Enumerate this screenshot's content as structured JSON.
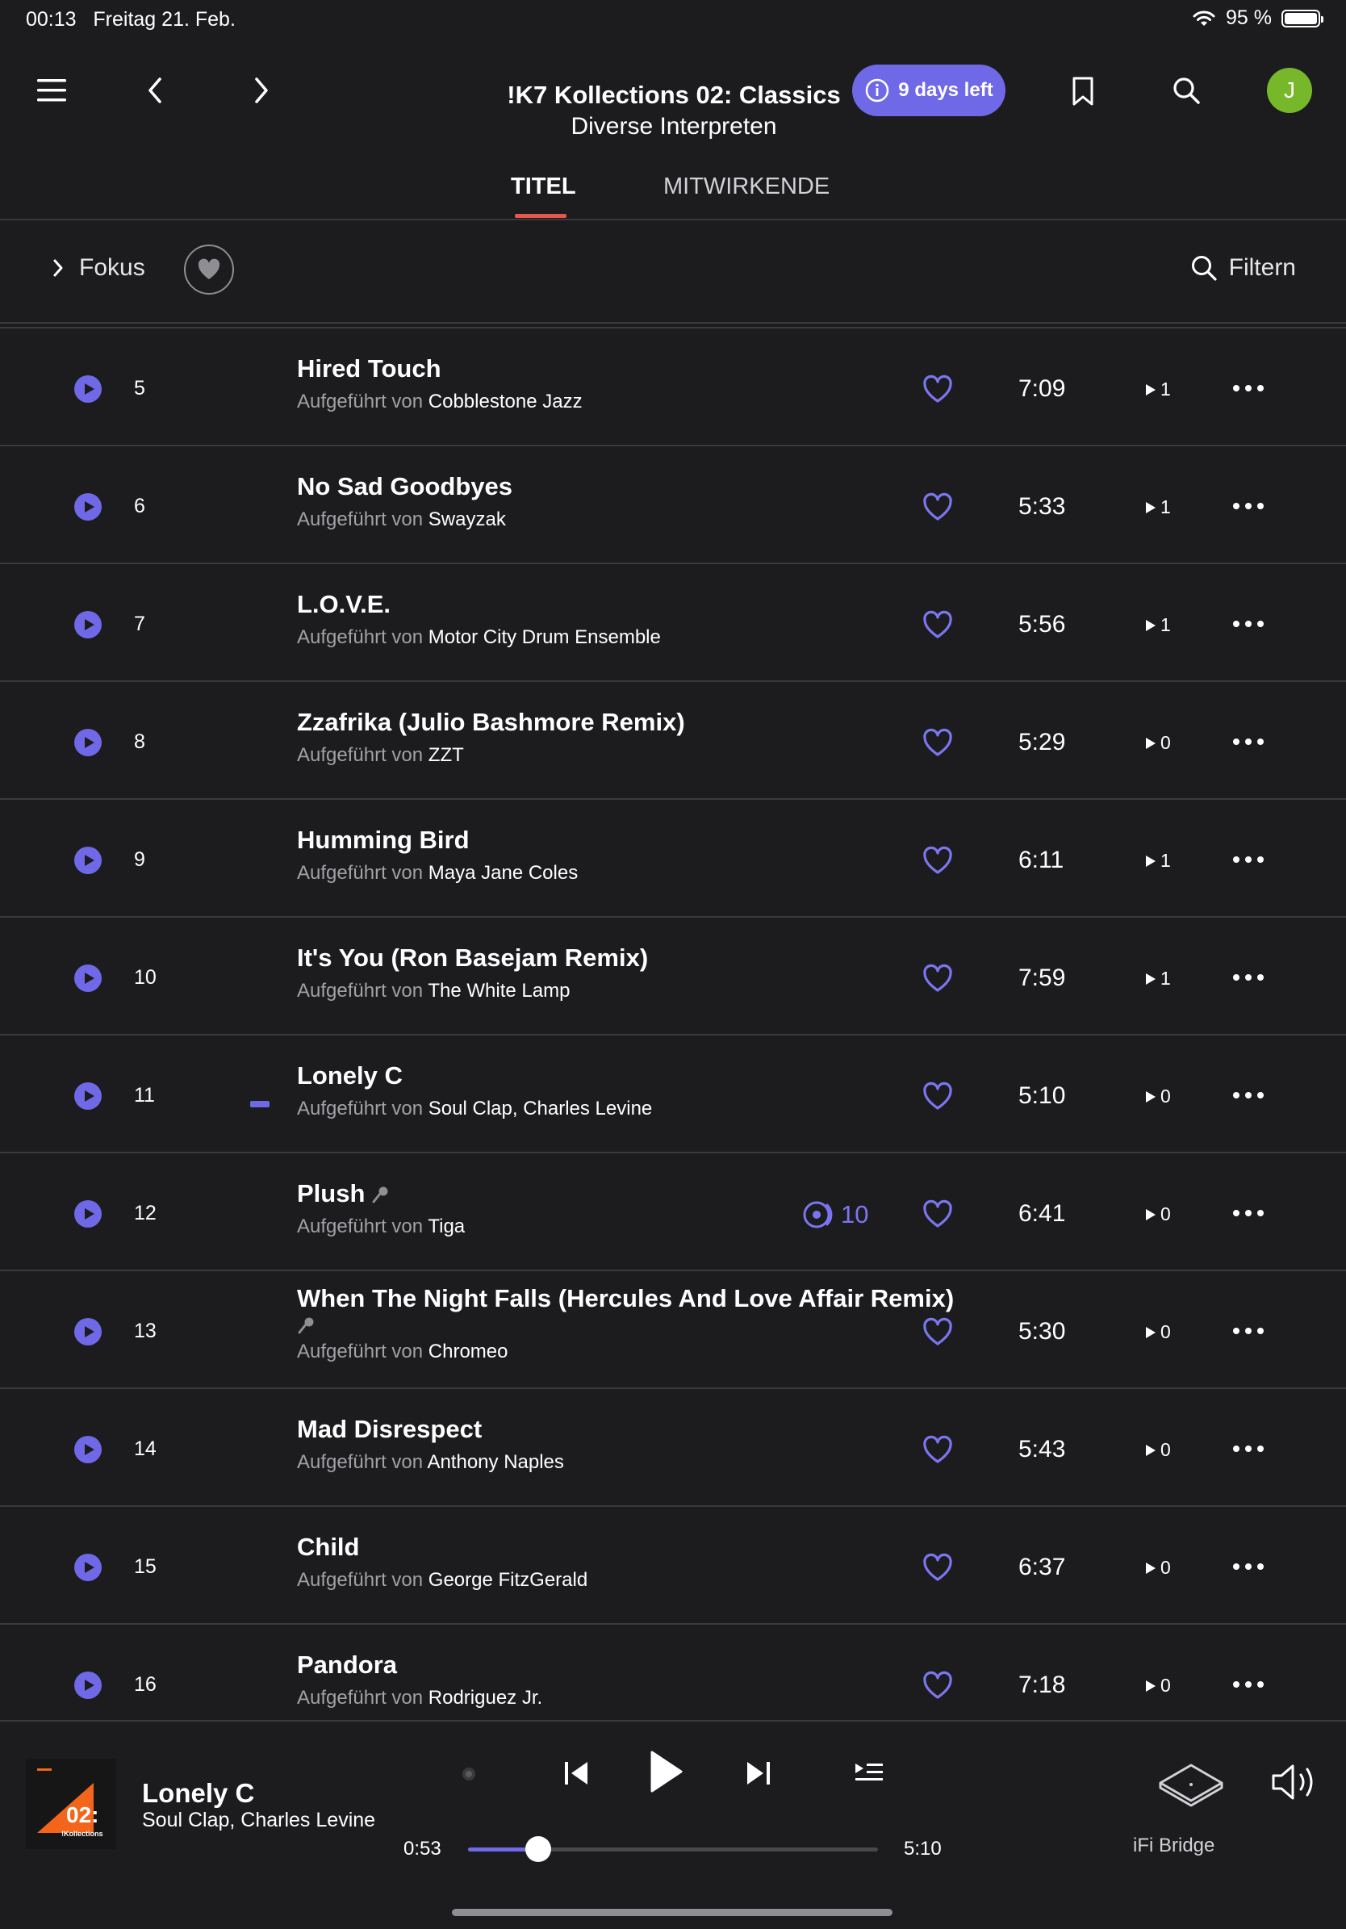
{
  "status": {
    "time": "00:13",
    "date": "Freitag 21. Feb.",
    "battery": "95 %"
  },
  "header": {
    "album_title": "!K7 Kollections 02: Classics",
    "album_artist": "Diverse Interpreten",
    "trial_label": "9 days left",
    "avatar_initial": "J"
  },
  "tabs": [
    {
      "label": "TITEL",
      "active": true
    },
    {
      "label": "MITWIRKENDE",
      "active": false
    }
  ],
  "filterbar": {
    "focus_label": "Fokus",
    "filter_label": "Filtern"
  },
  "performed_by_prefix": "Aufgeführt von",
  "tracks": [
    {
      "number": "5",
      "title": "Hired Touch",
      "artist": "Cobblestone Jazz",
      "duration": "7:09",
      "plays": "1"
    },
    {
      "number": "6",
      "title": "No Sad Goodbyes",
      "artist": "Swayzak",
      "duration": "5:33",
      "plays": "1"
    },
    {
      "number": "7",
      "title": "L.O.V.E.",
      "artist": "Motor City Drum Ensemble",
      "duration": "5:56",
      "plays": "1"
    },
    {
      "number": "8",
      "title": "Zzafrika (Julio Bashmore Remix)",
      "artist": "ZZT",
      "duration": "5:29",
      "plays": "0"
    },
    {
      "number": "9",
      "title": "Humming Bird",
      "artist": "Maya Jane Coles",
      "duration": "6:11",
      "plays": "1"
    },
    {
      "number": "10",
      "title": "It's You (Ron Basejam Remix)",
      "artist": "The White Lamp",
      "duration": "7:59",
      "plays": "1"
    },
    {
      "number": "11",
      "title": "Lonely C",
      "artist_a": "Soul Clap",
      "artist_b": "Charles Levine",
      "duration": "5:10",
      "plays": "0",
      "now_playing": true
    },
    {
      "number": "12",
      "title": "Plush",
      "artist": "Tiga",
      "duration": "6:41",
      "plays": "0",
      "radio_count": "10"
    },
    {
      "number": "13",
      "title": "When The Night Falls (Hercules And Love Affair Remix)",
      "artist": "Chromeo",
      "duration": "5:30",
      "plays": "0"
    },
    {
      "number": "14",
      "title": "Mad Disrespect",
      "artist": "Anthony Naples",
      "duration": "5:43",
      "plays": "0"
    },
    {
      "number": "15",
      "title": "Child",
      "artist": "George FitzGerald",
      "duration": "6:37",
      "plays": "0"
    },
    {
      "number": "16",
      "title": "Pandora",
      "artist": "Rodriguez Jr.",
      "duration": "7:18",
      "plays": "0"
    }
  ],
  "player": {
    "title": "Lonely C",
    "artist": "Soul Clap, Charles Levine",
    "elapsed": "0:53",
    "total": "5:10",
    "progress_fraction": 0.171,
    "device": "iFi Bridge",
    "cover_text": "02:",
    "cover_subtext": "!Kollections"
  },
  "colors": {
    "accent": "#6f69e8",
    "tab_underline": "#e4574a",
    "avatar": "#76b82a",
    "background": "#1c1c1e"
  }
}
